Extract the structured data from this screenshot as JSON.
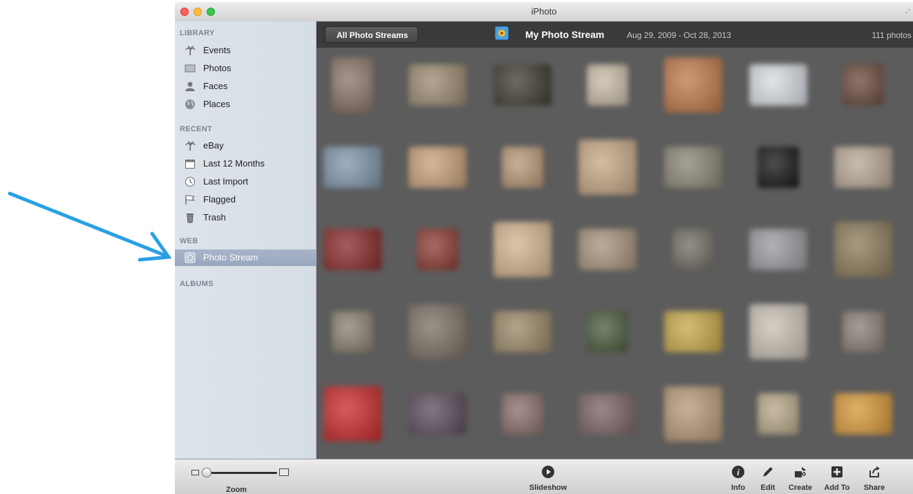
{
  "window": {
    "title": "iPhoto"
  },
  "sidebar": {
    "sections": [
      {
        "label": "LIBRARY",
        "items": [
          {
            "label": "Events",
            "icon": "palm-tree-icon"
          },
          {
            "label": "Photos",
            "icon": "photos-icon"
          },
          {
            "label": "Faces",
            "icon": "faces-icon"
          },
          {
            "label": "Places",
            "icon": "globe-icon"
          }
        ]
      },
      {
        "label": "RECENT",
        "items": [
          {
            "label": "eBay",
            "icon": "palm-tree-icon"
          },
          {
            "label": "Last 12 Months",
            "icon": "calendar-icon"
          },
          {
            "label": "Last Import",
            "icon": "clock-icon"
          },
          {
            "label": "Flagged",
            "icon": "flag-icon"
          },
          {
            "label": "Trash",
            "icon": "trash-icon"
          }
        ]
      },
      {
        "label": "WEB",
        "items": [
          {
            "label": "Photo Stream",
            "icon": "photo-stream-icon",
            "selected": true
          }
        ]
      },
      {
        "label": "ALBUMS",
        "items": []
      }
    ]
  },
  "header": {
    "back_button": "All Photo Streams",
    "stream_title": "My Photo Stream",
    "date_range": "Aug 29, 2009 - Oct 28, 2013",
    "count": "111 photos"
  },
  "toolbar": {
    "zoom_label": "Zoom",
    "zoom_level": 0,
    "slideshow_label": "Slideshow",
    "info_label": "Info",
    "edit_label": "Edit",
    "create_label": "Create",
    "add_to_label": "Add To",
    "share_label": "Share"
  },
  "colors": {
    "arrow": "#2aa0e4",
    "selection": "#9fadc4",
    "sidebar_bg": "#dae0e8",
    "grid_bg": "#5c5c5c",
    "header_bg": "#3a3a3a"
  },
  "photos": [
    [
      "#8a7468",
      "#9b8a70",
      "#3e3a30",
      "#c8bca6",
      "#c07848",
      "#d8dce2",
      "#6a4a3c"
    ],
    [
      "#7e96ac",
      "#c8a078",
      "#b89878",
      "#c8a886",
      "#8a8674",
      "#141414",
      "#b8a896"
    ],
    [
      "#8a2828",
      "#8c3a30",
      "#d4b490",
      "#a8927a",
      "#706c62",
      "#9a9aa0",
      "#8a7a58"
    ],
    [
      "#8a8070",
      "#7a6e62",
      "#9a8866",
      "#4a5a3a",
      "#c8a848",
      "#c8c0b4",
      "#8a7e76"
    ],
    [
      "#c82828",
      "#5a4a5a",
      "#8a6e6a",
      "#7a6262",
      "#b89878",
      "#b8a888",
      "#d89838"
    ]
  ]
}
